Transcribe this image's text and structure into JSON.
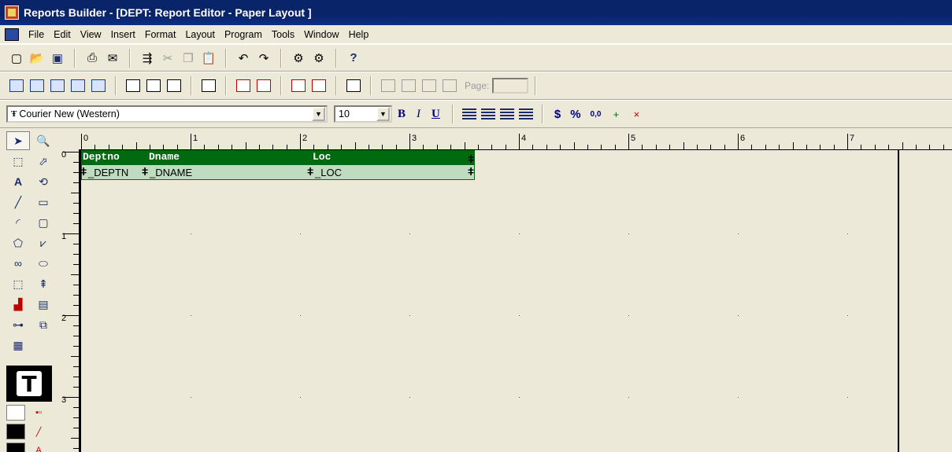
{
  "window": {
    "title": "Reports Builder - [DEPT: Report Editor - Paper Layout ]"
  },
  "menu": [
    "File",
    "Edit",
    "View",
    "Insert",
    "Format",
    "Layout",
    "Program",
    "Tools",
    "Window",
    "Help"
  ],
  "font_toolbar": {
    "font_name": "Courier New (Western)",
    "font_size": "10",
    "bold": "B",
    "italic": "I",
    "underline": "U",
    "currency": "$",
    "percent": "%",
    "commas": "0,0"
  },
  "nav_toolbar": {
    "page_label": "Page:",
    "page_value": ""
  },
  "ruler": {
    "horizontal_labels": [
      "0",
      "1",
      "2",
      "3",
      "4",
      "5",
      "6",
      "7"
    ],
    "vertical_labels": [
      "0",
      "1",
      "2",
      "3"
    ]
  },
  "report": {
    "header_labels": [
      "Deptno",
      "Dname",
      "Loc"
    ],
    "fields": [
      "F_DEPTNO",
      "F_DNAME",
      "F_LOC"
    ],
    "field_display": [
      "_DEPTN",
      "_DNAME",
      "_LOC"
    ]
  },
  "colors": {
    "title_bar": "#0a246a",
    "header_band": "#006a10",
    "repeating_frame": "#c0dcc0"
  }
}
